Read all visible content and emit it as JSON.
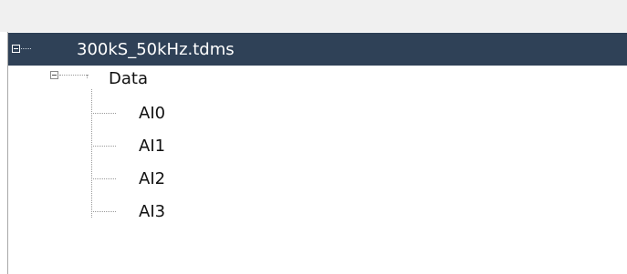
{
  "tree": {
    "root": {
      "label": "300kS_50kHz.tdms",
      "expanded": true,
      "selected": true
    },
    "group": {
      "label": "Data",
      "expanded": true
    },
    "channels": [
      "AI0",
      "AI1",
      "AI2",
      "AI3"
    ]
  },
  "colors": {
    "selection_background": "#2f4157",
    "selection_text": "#ffffff",
    "text": "#111111",
    "toolbar_background": "#f0f0f0"
  },
  "icons": {
    "root_expander": "collapse-box-icon",
    "group_expander": "collapse-box-icon"
  }
}
